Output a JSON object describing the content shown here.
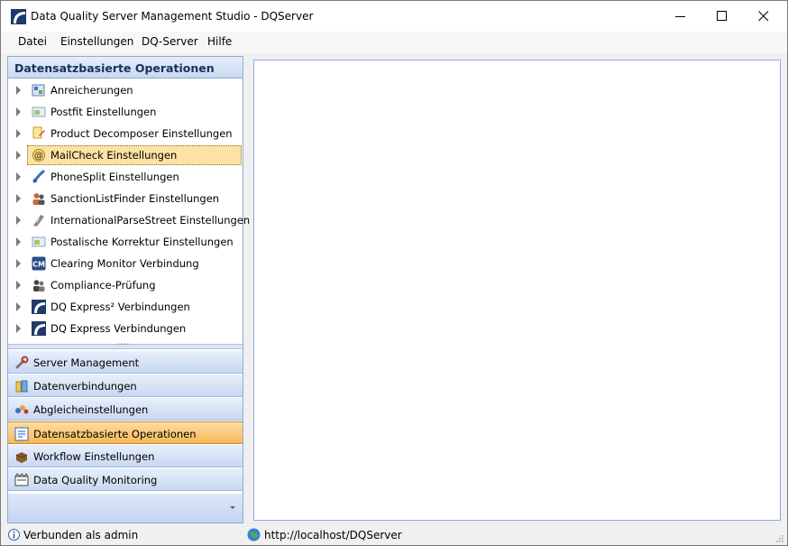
{
  "window": {
    "title": "Data Quality Server Management Studio - DQServer"
  },
  "menu": {
    "items": [
      "Datei",
      "Einstellungen",
      "DQ-Server",
      "Hilfe"
    ]
  },
  "left_panel": {
    "header": "Datensatzbasierte Operationen",
    "tree_items": [
      {
        "label": "Anreicherungen",
        "icon": "enrichment-icon"
      },
      {
        "label": "Postfit Einstellungen",
        "icon": "postfit-icon"
      },
      {
        "label": "Product Decomposer Einstellungen",
        "icon": "product-decomposer-icon"
      },
      {
        "label": "MailCheck Einstellungen",
        "icon": "at-sign-icon",
        "selected": true
      },
      {
        "label": "PhoneSplit Einstellungen",
        "icon": "phone-icon"
      },
      {
        "label": "SanctionListFinder Einstellungen",
        "icon": "people-icon"
      },
      {
        "label": "InternationalParseStreet Einstellungen",
        "icon": "street-icon"
      },
      {
        "label": "Postalische Korrektur Einstellungen",
        "icon": "postal-correction-icon"
      },
      {
        "label": "Clearing Monitor Verbindung",
        "icon": "cm-icon"
      },
      {
        "label": "Compliance-Prüfung",
        "icon": "compliance-icon"
      },
      {
        "label": "DQ Express² Verbindungen",
        "icon": "dq-logo-icon"
      },
      {
        "label": "DQ Express Verbindungen",
        "icon": "dq-logo-icon"
      }
    ],
    "nav_buttons": [
      {
        "label": "Server Management",
        "icon": "wrench-icon"
      },
      {
        "label": "Datenverbindungen",
        "icon": "database-icon"
      },
      {
        "label": "Abgleicheinstellungen",
        "icon": "matching-icon"
      },
      {
        "label": "Datensatzbasierte Operationen",
        "icon": "record-ops-icon",
        "active": true
      },
      {
        "label": "Workflow Einstellungen",
        "icon": "workflow-icon"
      },
      {
        "label": "Data Quality Monitoring",
        "icon": "monitoring-icon"
      }
    ]
  },
  "status": {
    "user": "Verbunden als admin",
    "url": "http://localhost/DQServer"
  },
  "colors": {
    "panel_border": "#8eaad4",
    "selection": "#fde2a6",
    "active_nav": "#f7b958"
  }
}
